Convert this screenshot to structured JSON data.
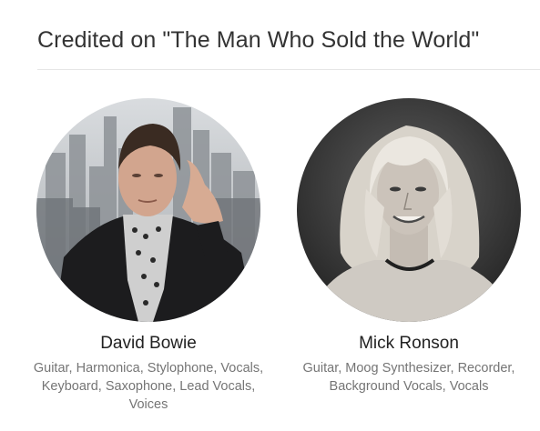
{
  "section": {
    "title": "Credited on \"The Man Who Sold the World\""
  },
  "credits": [
    {
      "name": "David Bowie",
      "roles": "Guitar, Harmonica, Stylophone, Vocals, Keyboard, Saxophone, Lead Vocals, Voices",
      "avatar_icon": "artist-photo"
    },
    {
      "name": "Mick Ronson",
      "roles": "Guitar, Moog Synthesizer, Recorder, Background Vocals, Vocals",
      "avatar_icon": "artist-photo"
    }
  ]
}
